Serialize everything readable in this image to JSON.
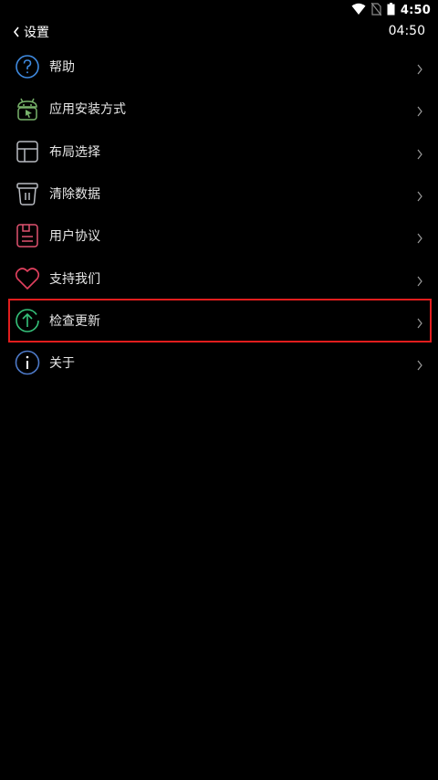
{
  "status_bar": {
    "time": "4:50",
    "icons": [
      "wifi-icon",
      "no-sim-icon",
      "battery-icon"
    ]
  },
  "header": {
    "back_label": "设置",
    "clock": "04:50"
  },
  "menu": {
    "items": [
      {
        "label": "帮助",
        "icon": "help-icon",
        "color": "#3f8ae0"
      },
      {
        "label": "应用安装方式",
        "icon": "android-icon",
        "color": "#78b36b"
      },
      {
        "label": "布局选择",
        "icon": "layout-icon",
        "color": "#b9bcc2"
      },
      {
        "label": "清除数据",
        "icon": "trash-icon",
        "color": "#b9bcc2"
      },
      {
        "label": "用户协议",
        "icon": "document-icon",
        "color": "#e05270"
      },
      {
        "label": "支持我们",
        "icon": "heart-icon",
        "color": "#e0405e"
      },
      {
        "label": "检查更新",
        "icon": "upload-arrow-icon",
        "color": "#35c27a"
      },
      {
        "label": "关于",
        "icon": "info-icon",
        "color": "#4d79c7"
      }
    ],
    "highlight_color": "#e11d1d"
  }
}
